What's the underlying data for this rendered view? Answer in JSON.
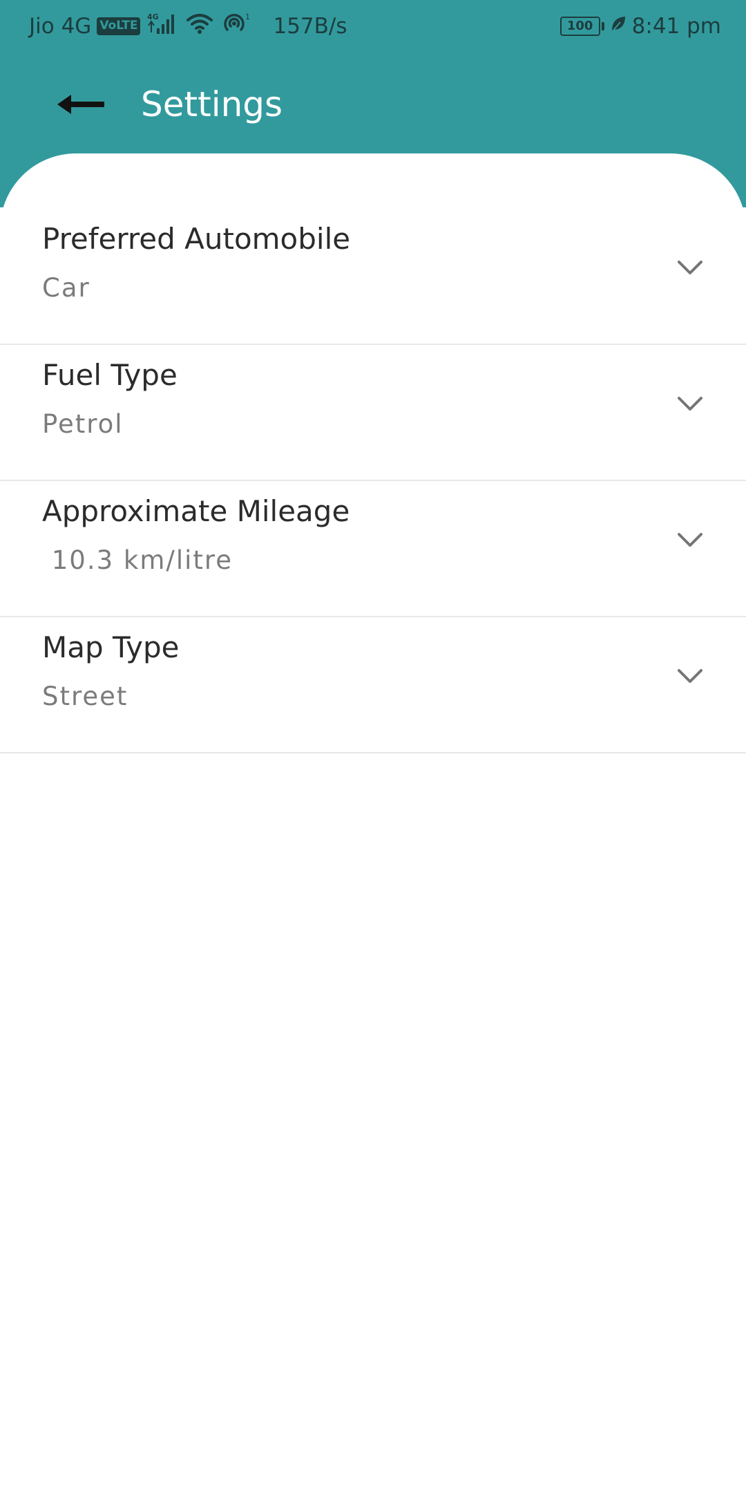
{
  "status_bar": {
    "carrier": "Jio 4G",
    "volte": "VoLTE",
    "network_gen": "4G",
    "hotspot_count": "1",
    "speed": "157B/s",
    "battery": "100",
    "time": "8:41 pm"
  },
  "app_bar": {
    "title": "Settings",
    "back_icon": "arrow-left-icon"
  },
  "settings": [
    {
      "label": "Preferred Automobile",
      "value": "Car"
    },
    {
      "label": "Fuel Type",
      "value": "Petrol"
    },
    {
      "label": "Approximate Mileage",
      "value": " 10.3 km/litre"
    },
    {
      "label": "Map Type",
      "value": "Street"
    }
  ],
  "icons": {
    "dropdown": "chevron-down-icon"
  },
  "colors": {
    "header": "#329a9d",
    "title_text": "#ffffff",
    "label_text": "#2b2b2b",
    "value_text": "#7b7b7b",
    "divider": "#e8e8e8",
    "chevron": "#757575"
  }
}
